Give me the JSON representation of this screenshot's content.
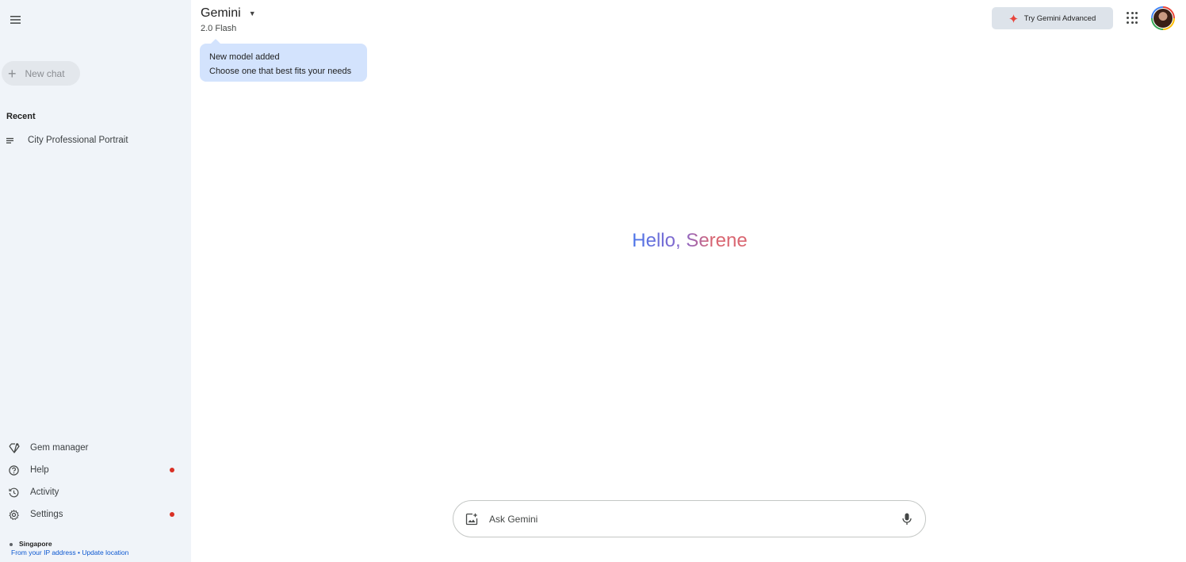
{
  "sidebar": {
    "new_chat_label": "New chat",
    "recent_title": "Recent",
    "recent_items": [
      {
        "label": "City Professional Portrait"
      }
    ],
    "bottom_items": [
      {
        "label": "Gem manager",
        "icon": "gem-icon",
        "has_dot": false
      },
      {
        "label": "Help",
        "icon": "help-icon",
        "has_dot": true
      },
      {
        "label": "Activity",
        "icon": "history-icon",
        "has_dot": false
      },
      {
        "label": "Settings",
        "icon": "gear-icon",
        "has_dot": true
      }
    ],
    "location": {
      "city": "Singapore",
      "source": "From your IP address",
      "separator": "•",
      "update_link": "Update location"
    }
  },
  "header": {
    "title": "Gemini",
    "model": "2.0 Flash",
    "tooltip": {
      "title": "New model added",
      "text": "Choose one that best fits your needs"
    },
    "try_advanced_label": "Try Gemini Advanced"
  },
  "main": {
    "greeting": "Hello, Serene"
  },
  "input": {
    "placeholder": "Ask Gemini",
    "value": ""
  },
  "colors": {
    "sidebar_bg": "#f0f4f9",
    "tooltip_bg": "#d3e3fd",
    "notification_dot": "#d93025",
    "link": "#0b57d0",
    "spark": "#e8453c"
  }
}
